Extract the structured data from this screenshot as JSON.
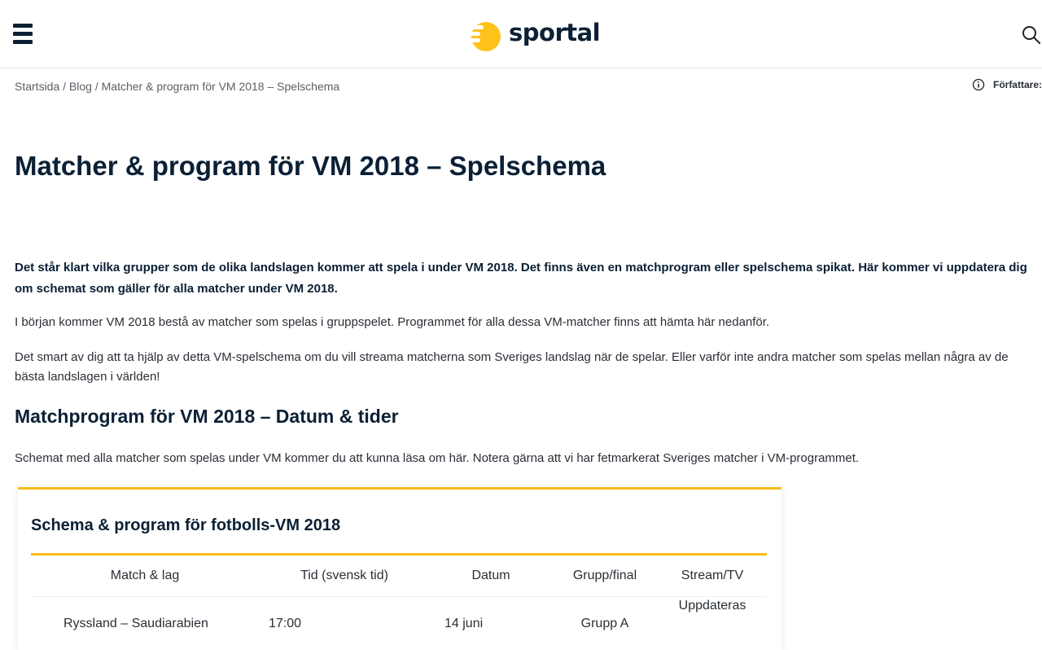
{
  "header": {
    "logo_text": "sportal",
    "logo_color": "#ffc21a",
    "menu_icon": "hamburger-menu-icon",
    "search_icon": "search-icon"
  },
  "breadcrumb": {
    "items": [
      "Startsida",
      "Blog",
      "Matcher & program för VM 2018 – Spelschema"
    ],
    "separator": "/"
  },
  "author": {
    "label": "Författare:",
    "icon": "info-icon"
  },
  "article": {
    "title": "Matcher & program för VM 2018 – Spelschema",
    "lead": "Det står klart vilka grupper som de olika landslagen kommer att spela i under VM 2018. Det finns även en matchprogram eller spelschema spikat. Här kommer vi uppdatera dig om schemat som gäller för alla matcher under VM 2018.",
    "paragraph_1": "I början kommer VM 2018 bestå av matcher som spelas i gruppspelet. Programmet för alla dessa VM-matcher finns att hämta här nedanför.",
    "paragraph_2": "Det smart av dig att ta hjälp av detta VM-spelschema om du vill streama matcherna som Sveriges landslag när de spelar. Eller varför inte andra matcher som spelas mellan några av de bästa landslagen i världen!",
    "section_title": "Matchprogram för VM 2018 – Datum & tider",
    "paragraph_3": "Schemat med alla matcher som spelas under VM kommer du att kunna läsa om här. Notera gärna att vi har fetmarkerat Sveriges matcher i VM-programmet."
  },
  "schedule": {
    "title": "Schema & program för fotbolls-VM 2018",
    "columns": [
      "Match & lag",
      "Tid (svensk tid)",
      "Datum",
      "Grupp/final",
      "Stream/TV"
    ],
    "rows": [
      [
        "Ryssland – Saudiarabien",
        "17:00",
        "14 juni",
        "Grupp A",
        "Uppdateras"
      ]
    ]
  },
  "colors": {
    "accent": "#f7bd17",
    "heading": "#0b2035",
    "text": "#2a2f36"
  }
}
